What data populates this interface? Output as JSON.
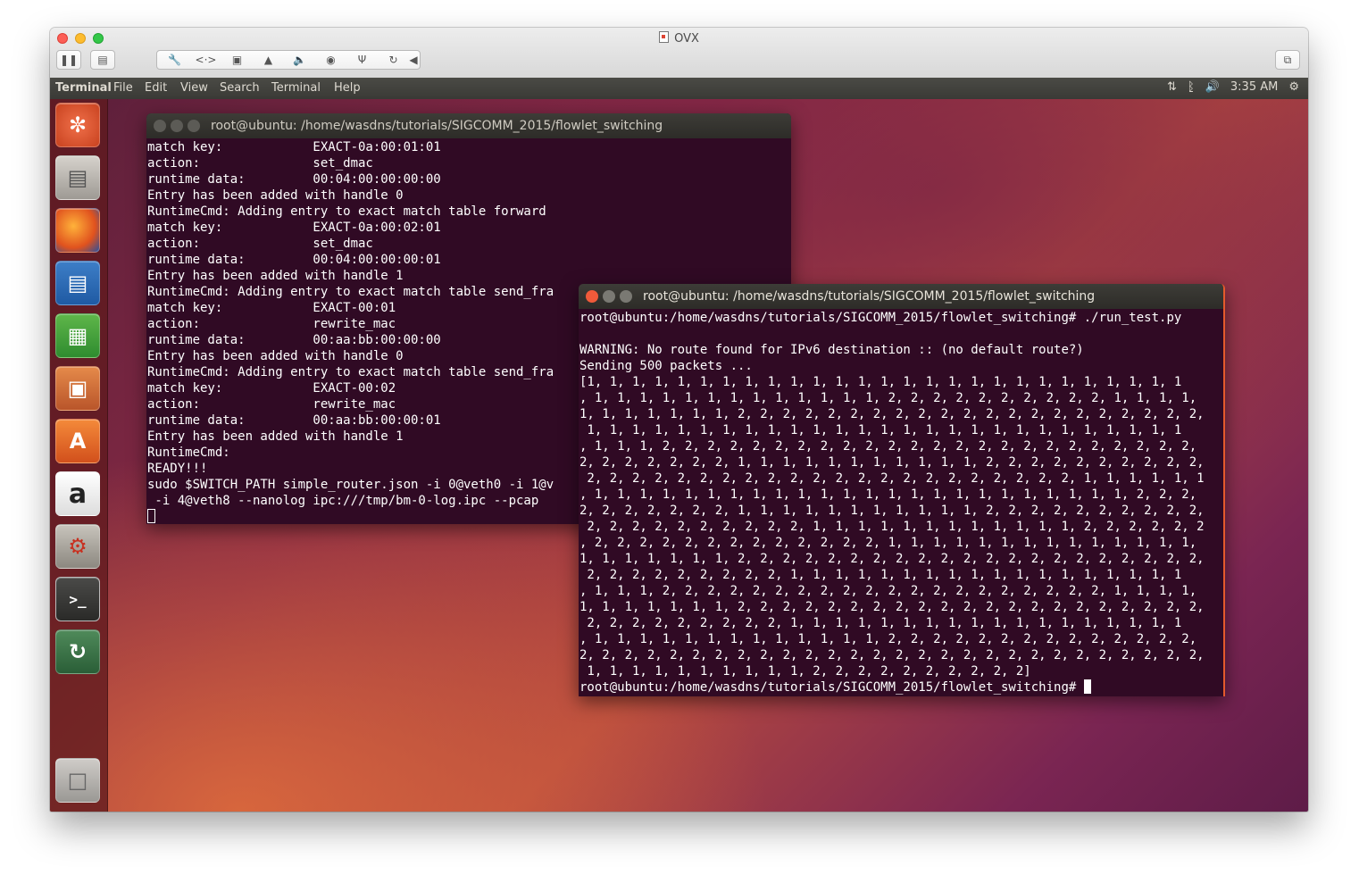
{
  "vm": {
    "title": "OVX",
    "toolbar_icons": [
      "wrench-icon",
      "code-icon",
      "disk-icon",
      "lock-icon",
      "speaker-icon",
      "camera-icon",
      "usb-icon",
      "sync-icon",
      "chevron-left-icon"
    ]
  },
  "panel": {
    "app_name": "Terminal",
    "menu": [
      "File",
      "Edit",
      "View",
      "Search",
      "Terminal",
      "Help"
    ],
    "clock": "3:35 AM"
  },
  "launcher": {
    "items": [
      "ubuntu-dash-icon",
      "files-icon",
      "firefox-icon",
      "writer-icon",
      "calc-icon",
      "impress-icon",
      "software-center-icon",
      "amazon-icon",
      "settings-icon",
      "terminal-icon",
      "update-manager-icon",
      "trash-icon"
    ]
  },
  "term1": {
    "title": "root@ubuntu: /home/wasdns/tutorials/SIGCOMM_2015/flowlet_switching",
    "lines": [
      "match key:            EXACT-0a:00:01:01",
      "action:               set_dmac",
      "runtime data:         00:04:00:00:00:00",
      "Entry has been added with handle 0",
      "RuntimeCmd: Adding entry to exact match table forward",
      "match key:            EXACT-0a:00:02:01",
      "action:               set_dmac",
      "runtime data:         00:04:00:00:00:01",
      "Entry has been added with handle 1",
      "RuntimeCmd: Adding entry to exact match table send_fra",
      "match key:            EXACT-00:01",
      "action:               rewrite_mac",
      "runtime data:         00:aa:bb:00:00:00",
      "Entry has been added with handle 0",
      "RuntimeCmd: Adding entry to exact match table send_fra",
      "match key:            EXACT-00:02",
      "action:               rewrite_mac",
      "runtime data:         00:aa:bb:00:00:01",
      "Entry has been added with handle 1",
      "RuntimeCmd:",
      "READY!!!",
      "sudo $SWITCH_PATH simple_router.json -i 0@veth0 -i 1@v",
      " -i 4@veth8 --nanolog ipc:///tmp/bm-0-log.ipc --pcap"
    ]
  },
  "term2": {
    "title": "root@ubuntu: /home/wasdns/tutorials/SIGCOMM_2015/flowlet_switching",
    "lines": [
      "root@ubuntu:/home/wasdns/tutorials/SIGCOMM_2015/flowlet_switching# ./run_test.py",
      "",
      "WARNING: No route found for IPv6 destination :: (no default route?)",
      "Sending 500 packets ...",
      "[1, 1, 1, 1, 1, 1, 1, 1, 1, 1, 1, 1, 1, 1, 1, 1, 1, 1, 1, 1, 1, 1, 1, 1, 1, 1, 1",
      ", 1, 1, 1, 1, 1, 1, 1, 1, 1, 1, 1, 1, 1, 2, 2, 2, 2, 2, 2, 2, 2, 2, 2, 1, 1, 1, 1,",
      "1, 1, 1, 1, 1, 1, 1, 2, 2, 2, 2, 2, 2, 2, 2, 2, 2, 2, 2, 2, 2, 2, 2, 2, 2, 2, 2, 2,",
      " 1, 1, 1, 1, 1, 1, 1, 1, 1, 1, 1, 1, 1, 1, 1, 1, 1, 1, 1, 1, 1, 1, 1, 1, 1, 1, 1",
      ", 1, 1, 1, 2, 2, 2, 2, 2, 2, 2, 2, 2, 2, 2, 2, 2, 2, 2, 2, 2, 2, 2, 2, 2, 2, 2, 2,",
      "2, 2, 2, 2, 2, 2, 2, 1, 1, 1, 1, 1, 1, 1, 1, 1, 1, 1, 2, 2, 2, 2, 2, 2, 2, 2, 2, 2,",
      " 2, 2, 2, 2, 2, 2, 2, 2, 2, 2, 2, 2, 2, 2, 2, 2, 2, 2, 2, 2, 2, 2, 1, 1, 1, 1, 1, 1",
      ", 1, 1, 1, 1, 1, 1, 1, 1, 1, 1, 1, 1, 1, 1, 1, 1, 1, 1, 1, 1, 1, 1, 1, 1, 2, 2, 2,",
      "2, 2, 2, 2, 2, 2, 2, 1, 1, 1, 1, 1, 1, 1, 1, 1, 1, 1, 2, 2, 2, 2, 2, 2, 2, 2, 2, 2,",
      " 2, 2, 2, 2, 2, 2, 2, 2, 2, 2, 1, 1, 1, 1, 1, 1, 1, 1, 1, 1, 1, 1, 2, 2, 2, 2, 2, 2",
      ", 2, 2, 2, 2, 2, 2, 2, 2, 2, 2, 2, 2, 2, 1, 1, 1, 1, 1, 1, 1, 1, 1, 1, 1, 1, 1, 1,",
      "1, 1, 1, 1, 1, 1, 1, 2, 2, 2, 2, 2, 2, 2, 2, 2, 2, 2, 2, 2, 2, 2, 2, 2, 2, 2, 2, 2,",
      " 2, 2, 2, 2, 2, 2, 2, 2, 2, 1, 1, 1, 1, 1, 1, 1, 1, 1, 1, 1, 1, 1, 1, 1, 1, 1, 1",
      ", 1, 1, 1, 2, 2, 2, 2, 2, 2, 2, 2, 2, 2, 2, 2, 2, 2, 2, 2, 2, 2, 2, 2, 1, 1, 1, 1,",
      "1, 1, 1, 1, 1, 1, 1, 2, 2, 2, 2, 2, 2, 2, 2, 2, 2, 2, 2, 2, 2, 2, 2, 2, 2, 2, 2, 2,",
      " 2, 2, 2, 2, 2, 2, 2, 2, 2, 1, 1, 1, 1, 1, 1, 1, 1, 1, 1, 1, 1, 1, 1, 1, 1, 1, 1",
      ", 1, 1, 1, 1, 1, 1, 1, 1, 1, 1, 1, 1, 1, 2, 2, 2, 2, 2, 2, 2, 2, 2, 2, 2, 2, 2, 2,",
      "2, 2, 2, 2, 2, 2, 2, 2, 2, 2, 2, 2, 2, 2, 2, 2, 2, 2, 2, 2, 2, 2, 2, 2, 2, 2, 2, 2,",
      " 1, 1, 1, 1, 1, 1, 1, 1, 1, 1, 2, 2, 2, 2, 2, 2, 2, 2, 2, 2]"
    ],
    "prompt": "root@ubuntu:/home/wasdns/tutorials/SIGCOMM_2015/flowlet_switching# "
  }
}
